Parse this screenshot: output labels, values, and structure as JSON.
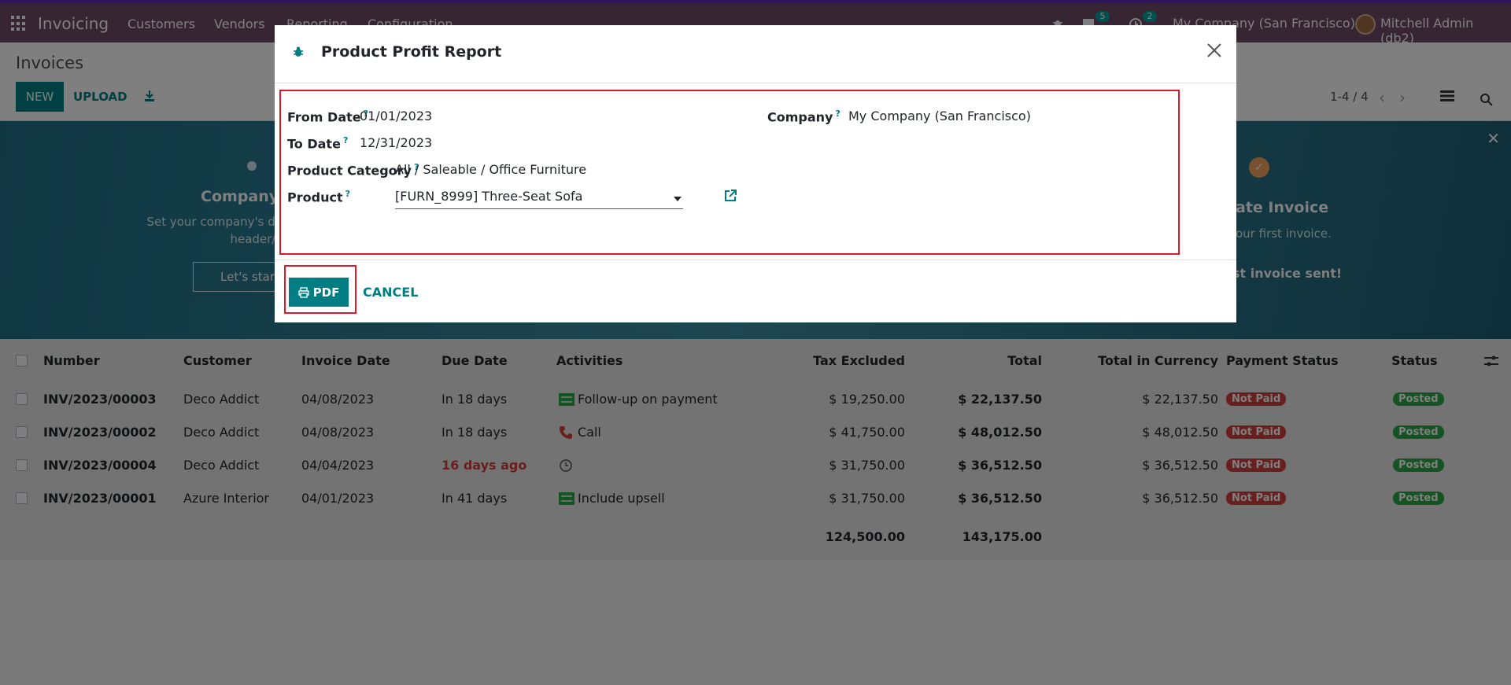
{
  "navbar": {
    "app_name": "Invoicing",
    "menus": [
      "Customers",
      "Vendors",
      "Reporting",
      "Configuration"
    ],
    "messages_count": "5",
    "activities_count": "2",
    "company": "My Company (San Francisco)",
    "user": "Mitchell Admin (db2)"
  },
  "control_panel": {
    "title": "Invoices",
    "new_label": "NEW",
    "upload_label": "UPLOAD",
    "pager": "1-4 / 4"
  },
  "banner": {
    "left_title": "Company D",
    "left_desc_line1": "Set your company's data",
    "left_desc_line2": "header/foo",
    "left_button": "Let's star",
    "right_title": "ate Invoice",
    "right_desc": "our first invoice.",
    "right_sent": "st invoice sent!"
  },
  "table": {
    "headers": [
      "Number",
      "Customer",
      "Invoice Date",
      "Due Date",
      "Activities",
      "Tax Excluded",
      "Total",
      "Total in Currency",
      "Payment Status",
      "Status"
    ],
    "rows": [
      {
        "number": "INV/2023/00003",
        "customer": "Deco Addict",
        "invoice_date": "04/08/2023",
        "due_date": "In 18 days",
        "activity": "Follow-up on payment",
        "tax_excluded": "$ 19,250.00",
        "total": "$ 22,137.50",
        "total_currency": "$ 22,137.50",
        "payment_status": "Not Paid",
        "status": "Posted"
      },
      {
        "number": "INV/2023/00002",
        "customer": "Deco Addict",
        "invoice_date": "04/08/2023",
        "due_date": "In 18 days",
        "activity": "Call",
        "tax_excluded": "$ 41,750.00",
        "total": "$ 48,012.50",
        "total_currency": "$ 48,012.50",
        "payment_status": "Not Paid",
        "status": "Posted"
      },
      {
        "number": "INV/2023/00004",
        "customer": "Deco Addict",
        "invoice_date": "04/04/2023",
        "due_date": "16 days ago",
        "activity": "",
        "tax_excluded": "$ 31,750.00",
        "total": "$ 36,512.50",
        "total_currency": "$ 36,512.50",
        "payment_status": "Not Paid",
        "status": "Posted"
      },
      {
        "number": "INV/2023/00001",
        "customer": "Azure Interior",
        "invoice_date": "04/01/2023",
        "due_date": "In 41 days",
        "activity": "Include upsell",
        "tax_excluded": "$ 31,750.00",
        "total": "$ 36,512.50",
        "total_currency": "$ 36,512.50",
        "payment_status": "Not Paid",
        "status": "Posted"
      }
    ],
    "footer_tax_excluded": "124,500.00",
    "footer_total": "143,175.00"
  },
  "modal": {
    "title": "Product Profit Report",
    "help_mark": "?",
    "from_date_label": "From Date",
    "from_date": "01/01/2023",
    "to_date_label": "To Date",
    "to_date": "12/31/2023",
    "category_label": "Product Category",
    "category": "All / Saleable / Office Furniture",
    "product_label": "Product",
    "product": "[FURN_8999] Three-Seat Sofa",
    "company_label": "Company",
    "company": "My Company (San Francisco)",
    "pdf_label": "PDF",
    "cancel_label": "CANCEL"
  },
  "colors": {
    "navbar": "#714b67",
    "primary": "#017e84",
    "danger": "#d23f3a",
    "success": "#28a745",
    "highlight": "#e0182d"
  }
}
